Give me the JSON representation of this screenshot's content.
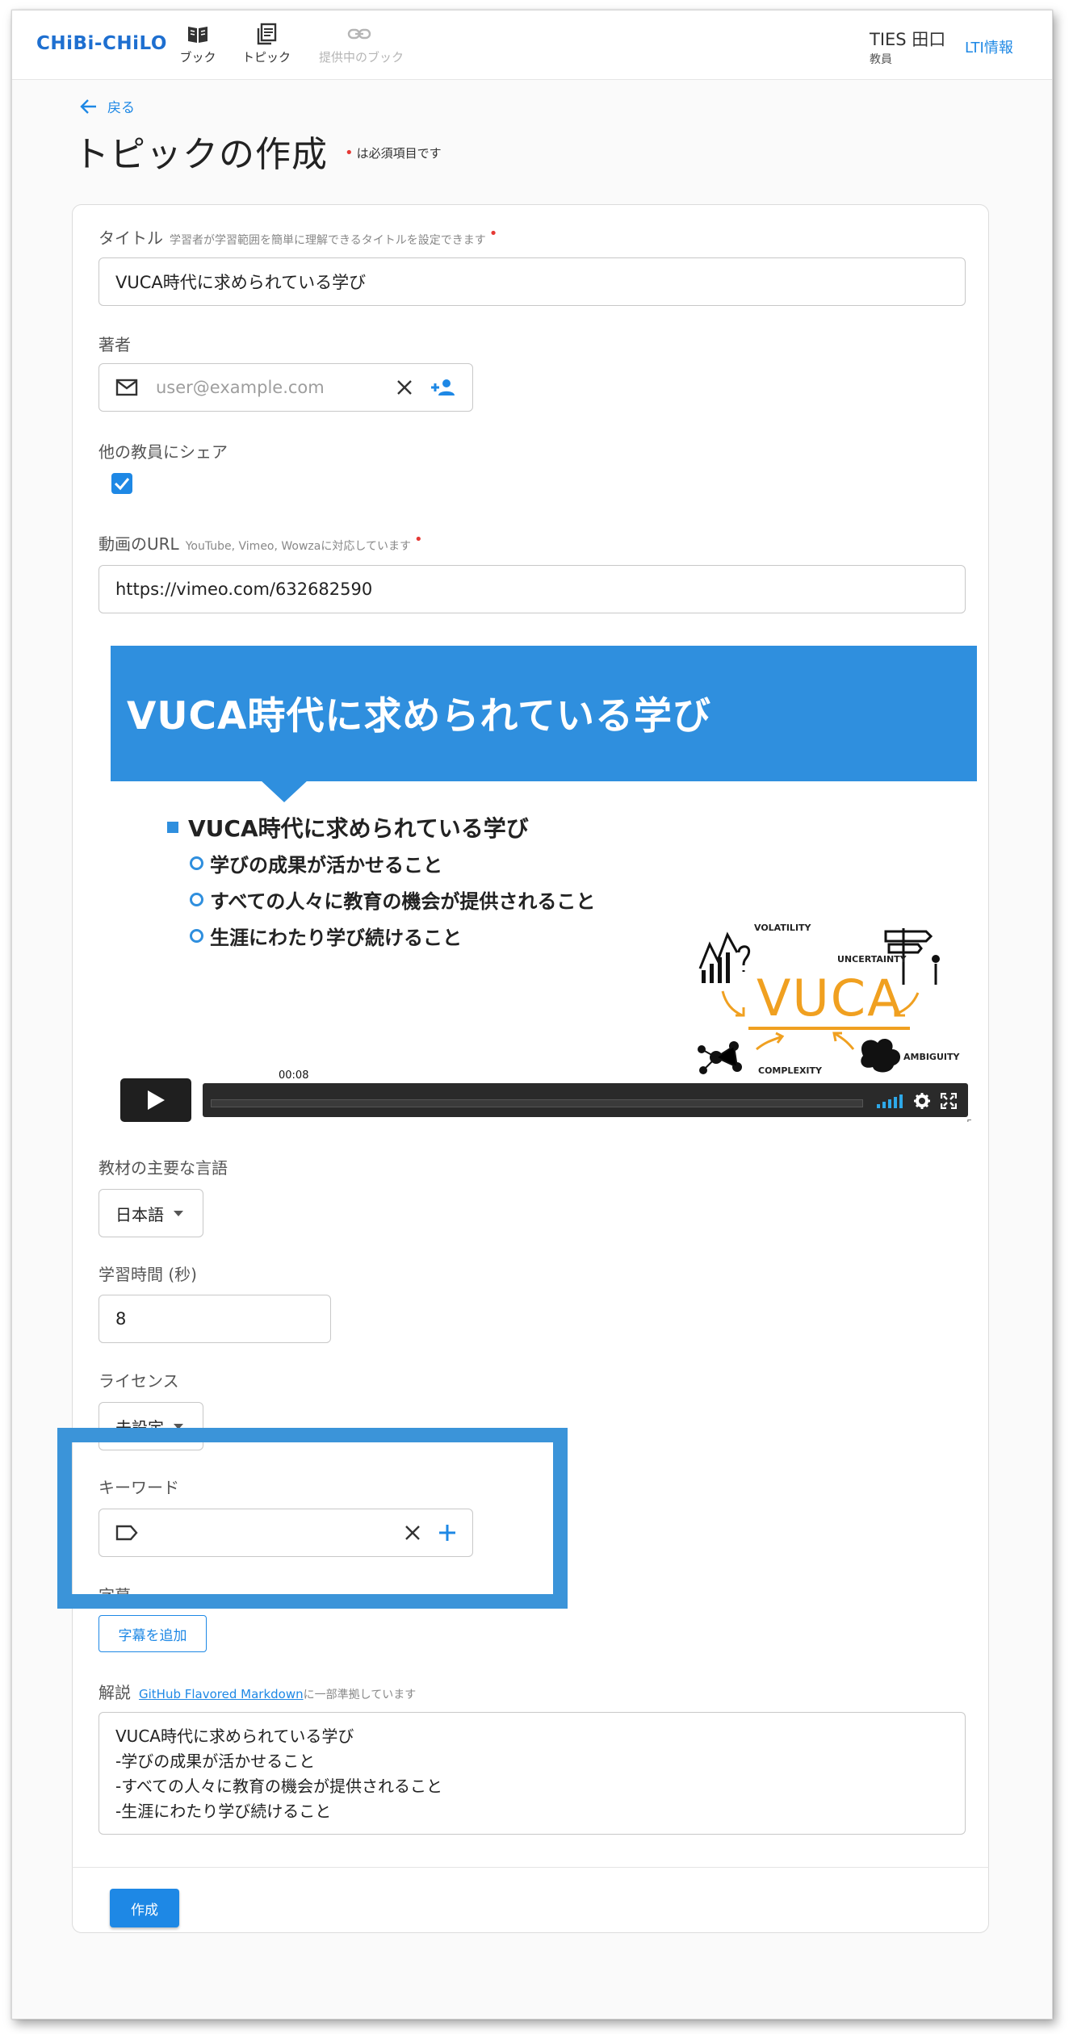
{
  "app": {
    "logo": "CHiBi-CHiLO",
    "nav": [
      {
        "label": "ブック",
        "icon": "book-icon",
        "disabled": false
      },
      {
        "label": "トピック",
        "icon": "topic-list-icon",
        "disabled": false
      },
      {
        "label": "提供中のブック",
        "icon": "link-icon",
        "disabled": true
      }
    ],
    "user": {
      "name": "TIES 田口",
      "role": "教員"
    },
    "lti_link": "LTI情報"
  },
  "header": {
    "back_label": "戻る",
    "title": "トピックの作成",
    "required_note": "は必須項目です"
  },
  "form": {
    "title": {
      "label": "タイトル",
      "hint": "学習者が学習範囲を簡単に理解できるタイトルを設定できます",
      "value": "VUCA時代に求められている学び"
    },
    "author": {
      "label": "著者",
      "placeholder": "user@example.com"
    },
    "share": {
      "label": "他の教員にシェア",
      "checked": true
    },
    "video_url": {
      "label": "動画のURL",
      "hint": "YouTube, Vimeo, Wowzaに対応しています",
      "value": "https://vimeo.com/632682590"
    },
    "video_preview": {
      "title": "VUCA時代に求められている学び",
      "bullet_main": "VUCA時代に求められている学び",
      "bullet_subs": [
        "学びの成果が活かせること",
        "すべての人々に教育の機会が提供されること",
        "生涯にわたり学び続けること"
      ],
      "vuca": "VUCA",
      "vuca_labels": [
        "VOLATILITY",
        "UNCERTAINTY",
        "COMPLEXITY",
        "AMBIGUITY"
      ],
      "time": "00:08",
      "progress": 0.0,
      "corner_num": "5"
    },
    "language": {
      "label": "教材の主要な言語",
      "value": "日本語"
    },
    "duration": {
      "label": "学習時間 (秒)",
      "value": "8"
    },
    "license": {
      "label": "ライセンス",
      "value": "未設定"
    },
    "keywords": {
      "label": "キーワード"
    },
    "subtitles": {
      "label": "字幕",
      "add_label": "字幕を追加"
    },
    "description": {
      "label": "解説",
      "link_text": "GitHub Flavored Markdown",
      "link_suffix": "に一部準拠しています",
      "lines": [
        "VUCA時代に求められている学び",
        "-学びの成果が活かせること",
        "-すべての人々に教育の機会が提供されること",
        "-生涯にわたり学び続けること"
      ]
    },
    "submit_label": "作成"
  },
  "colors": {
    "accent": "#1e88e5",
    "required": "#e53935",
    "highlight": "#3b94d9",
    "video_banner": "#2f8fde",
    "vuca": "#f0a020"
  }
}
